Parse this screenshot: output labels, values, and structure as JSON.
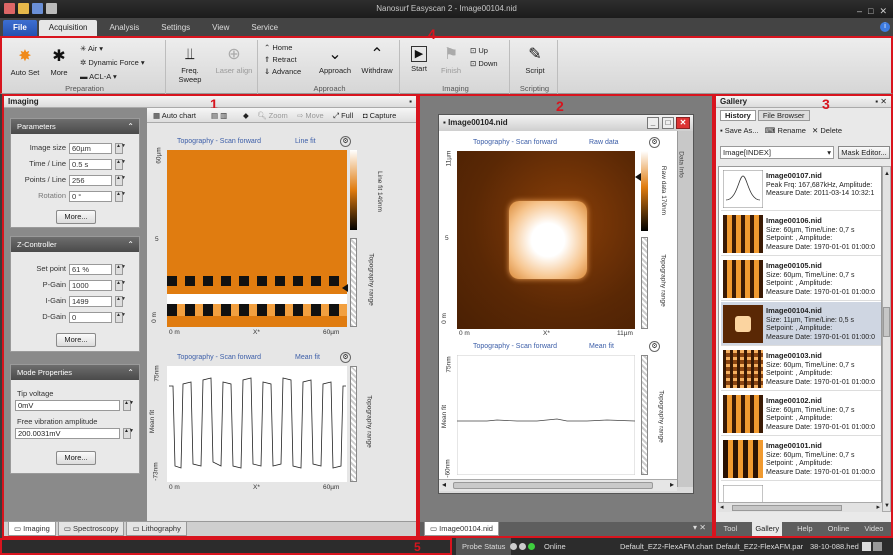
{
  "window": {
    "title": "Nanosurf Easyscan 2 - Image00104.nid"
  },
  "menu_tabs": [
    "File",
    "Acquisition",
    "Analysis",
    "Settings",
    "View",
    "Service"
  ],
  "ribbon": {
    "autoset": "Auto Set",
    "more": "More",
    "air": "Air",
    "dynamic_force": "Dynamic Force",
    "acl": "ACL-A",
    "preparation": "Preparation",
    "freq_sweep": "Freq. Sweep",
    "laser_align": "Laser align",
    "home": "Home",
    "retract": "Retract",
    "advance": "Advance",
    "approach_btn": "Approach",
    "withdraw": "Withdraw",
    "approach_group": "Approach",
    "start": "Start",
    "finish": "Finish",
    "up": "Up",
    "down": "Down",
    "imaging_group": "Imaging",
    "script": "Script",
    "scripting_group": "Scripting"
  },
  "markers": {
    "m1": "1",
    "m2": "2",
    "m3": "3",
    "m4": "4",
    "m5": "5"
  },
  "imaging": {
    "title": "Imaging",
    "parameters": {
      "title": "Parameters",
      "image_size_label": "Image size",
      "image_size": "60µm",
      "time_line_label": "Time / Line",
      "time_line": "0.5 s",
      "points_line_label": "Points / Line",
      "points_line": "256",
      "rotation_label": "Rotation",
      "rotation": "0 °",
      "more": "More..."
    },
    "zcontroller": {
      "title": "Z-Controller",
      "setpoint_label": "Set point",
      "setpoint": "61 %",
      "pgain_label": "P-Gain",
      "pgain": "1000",
      "igain_label": "I-Gain",
      "igain": "1499",
      "dgain_label": "D-Gain",
      "dgain": "0",
      "more": "More..."
    },
    "mode": {
      "title": "Mode Properties",
      "tip_voltage_label": "Tip voltage",
      "tip_voltage": "0mV",
      "free_vib_label": "Free vibration amplitude",
      "free_vib": "200.0031mV",
      "more": "More..."
    },
    "toolbar": {
      "autochart": "Auto chart",
      "zoom": "Zoom",
      "move": "Move",
      "full": "Full",
      "capture": "Capture"
    },
    "topo_plot": {
      "title": "Topography - Scan forward",
      "fit": "Line fit",
      "y_top": "60µm",
      "y_mid": "5",
      "y_bot": "0 m",
      "x_left": "0 m",
      "x_mid": "X*",
      "x_right": "60µm",
      "scale_label": "Line fit 149nm",
      "range_label": "Topography range"
    },
    "line_plot": {
      "title": "Topography - Scan forward",
      "fit": "Mean fit",
      "y_top": "75nm",
      "y_mid": "Mean fit",
      "y_bot": "-73nm",
      "x_left": "0 m",
      "x_mid": "X*",
      "x_right": "60µm",
      "range_label": "Topography range"
    },
    "bottom_tabs": [
      "Imaging",
      "Spectroscopy",
      "Lithography"
    ]
  },
  "doc": {
    "title": "Image00104.nid",
    "data_info": "Data Info",
    "topo_plot": {
      "title": "Topography - Scan forward",
      "fit": "Raw data",
      "y_top": "11µm",
      "y_mid": "5",
      "y_bot": "0 m",
      "x_left": "0 m",
      "x_mid": "X*",
      "x_right": "11µm",
      "scale_label": "Raw data 170nm",
      "range_label": "Topography range"
    },
    "line_plot": {
      "title": "Topography - Scan forward",
      "fit": "Mean fit",
      "y_top": "75nm",
      "y_mid": "Mean fit",
      "y_bot": "-60nm",
      "range_label": "Topography range"
    },
    "tab": "Image00104.nid"
  },
  "gallery": {
    "title": "Gallery",
    "tabs": [
      "History",
      "File Browser"
    ],
    "save_as": "Save As...",
    "rename": "Rename",
    "delete": "Delete",
    "filter": "Image[INDEX]",
    "mask_editor": "Mask Editor...",
    "items": [
      {
        "name": "Image00107.nid",
        "l1": "Peak Frq: 167,687kHz, Amplitude:",
        "l2": "Measure Date: 2011-03-14 10:32:1",
        "l3": ""
      },
      {
        "name": "Image00106.nid",
        "l1": "Size: 60µm, Time/Line: 0,7 s",
        "l2": "Setpoint: , Amplitude:",
        "l3": "Measure Date: 1970-01-01 01:00:0"
      },
      {
        "name": "Image00105.nid",
        "l1": "Size: 60µm, Time/Line: 0,7 s",
        "l2": "Setpoint: , Amplitude:",
        "l3": "Measure Date: 1970-01-01 01:00:0"
      },
      {
        "name": "Image00104.nid",
        "l1": "Size: 11µm, Time/Line: 0,5 s",
        "l2": "Setpoint: , Amplitude:",
        "l3": "Measure Date: 1970-01-01 01:00:0"
      },
      {
        "name": "Image00103.nid",
        "l1": "Size: 60µm, Time/Line: 0,7 s",
        "l2": "Setpoint: , Amplitude:",
        "l3": "Measure Date: 1970-01-01 01:00:0"
      },
      {
        "name": "Image00102.nid",
        "l1": "Size: 60µm, Time/Line: 0,7 s",
        "l2": "Setpoint: , Amplitude:",
        "l3": "Measure Date: 1970-01-01 01:00:0"
      },
      {
        "name": "Image00101.nid",
        "l1": "Size: 60µm, Time/Line: 0,7 s",
        "l2": "Setpoint: , Amplitude:",
        "l3": "Measure Date: 1970-01-01 01:00:0"
      }
    ],
    "bottom_tabs": [
      "Tool",
      "Gallery",
      "Help",
      "Online",
      "Video"
    ]
  },
  "status": {
    "probe_status": "Probe Status",
    "online": "Online",
    "chart_file": "Default_EZ2-FlexAFM.chart",
    "par_file": "Default_EZ2-FlexAFM.par",
    "hed_file": "38-10-088.hed"
  },
  "colors": {
    "accent_red": "#d8141e",
    "topo_orange": "#e07c10",
    "file_blue": "#2f5fc4"
  }
}
